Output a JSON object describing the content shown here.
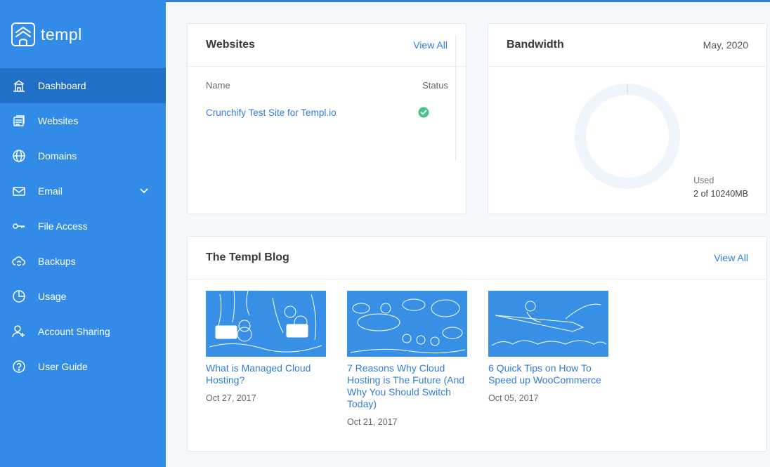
{
  "brand": {
    "name": "templ"
  },
  "sidebar": {
    "items": [
      {
        "label": "Dashboard",
        "icon": "dashboard-icon"
      },
      {
        "label": "Websites",
        "icon": "websites-icon"
      },
      {
        "label": "Domains",
        "icon": "globe-icon"
      },
      {
        "label": "Email",
        "icon": "envelope-icon"
      },
      {
        "label": "File Access",
        "icon": "key-icon"
      },
      {
        "label": "Backups",
        "icon": "cloud-sync-icon"
      },
      {
        "label": "Usage",
        "icon": "pie-chart-icon"
      },
      {
        "label": "Account Sharing",
        "icon": "user-plus-icon"
      },
      {
        "label": "User Guide",
        "icon": "help-icon"
      }
    ],
    "active": "Dashboard"
  },
  "websites": {
    "title": "Websites",
    "view_all": "View All",
    "columns": {
      "name": "Name",
      "status": "Status"
    },
    "rows": [
      {
        "name": "Crunchify Test Site for Templ.io",
        "status": "active"
      }
    ]
  },
  "bandwidth": {
    "title": "Bandwidth",
    "date": "May, 2020",
    "used_label": "Used",
    "used_value": "2 of 10240MB"
  },
  "blog": {
    "title": "The Templ Blog",
    "view_all": "View All",
    "posts": [
      {
        "title": "What is Managed Cloud Hosting?",
        "date": "Oct 27, 2017"
      },
      {
        "title": "7 Reasons Why Cloud Hosting is The Future (And Why You Should Switch Today)",
        "date": "Oct 21, 2017"
      },
      {
        "title": "6 Quick Tips on How To Speed up WooCommerce",
        "date": "Oct 05, 2017"
      }
    ]
  },
  "colors": {
    "sidebar": "#338be8",
    "sidebar_active": "#2170c8",
    "accent": "#2f7ed8",
    "success": "#4cc38a",
    "background": "#f4f8fd"
  }
}
